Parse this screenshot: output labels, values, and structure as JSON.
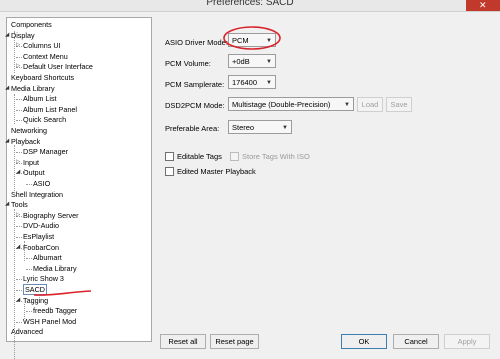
{
  "window": {
    "title": "Preferences: SACD",
    "close_label": "✕"
  },
  "tree": {
    "items": [
      {
        "label": "Components",
        "level": 0,
        "expander": ""
      },
      {
        "label": "Display",
        "level": 0,
        "expander": "◢"
      },
      {
        "label": "Columns UI",
        "level": 1,
        "expander": "▷"
      },
      {
        "label": "Context Menu",
        "level": 1,
        "expander": ""
      },
      {
        "label": "Default User Interface",
        "level": 1,
        "expander": "▷"
      },
      {
        "label": "Keyboard Shortcuts",
        "level": 0,
        "expander": ""
      },
      {
        "label": "Media Library",
        "level": 0,
        "expander": "◢"
      },
      {
        "label": "Album List",
        "level": 1,
        "expander": ""
      },
      {
        "label": "Album List Panel",
        "level": 1,
        "expander": ""
      },
      {
        "label": "Quick Search",
        "level": 1,
        "expander": ""
      },
      {
        "label": "Networking",
        "level": 0,
        "expander": ""
      },
      {
        "label": "Playback",
        "level": 0,
        "expander": "◢"
      },
      {
        "label": "DSP Manager",
        "level": 1,
        "expander": ""
      },
      {
        "label": "Input",
        "level": 1,
        "expander": "▷"
      },
      {
        "label": "Output",
        "level": 1,
        "expander": "◢"
      },
      {
        "label": "ASIO",
        "level": 2,
        "expander": ""
      },
      {
        "label": "Shell Integration",
        "level": 0,
        "expander": ""
      },
      {
        "label": "Tools",
        "level": 0,
        "expander": "◢"
      },
      {
        "label": "Biography Server",
        "level": 1,
        "expander": "▷"
      },
      {
        "label": "DVD-Audio",
        "level": 1,
        "expander": ""
      },
      {
        "label": "EsPlaylist",
        "level": 1,
        "expander": ""
      },
      {
        "label": "FoobarCon",
        "level": 1,
        "expander": "◢"
      },
      {
        "label": "Albumart",
        "level": 2,
        "expander": ""
      },
      {
        "label": "Media Library",
        "level": 2,
        "expander": ""
      },
      {
        "label": "Lyric Show 3",
        "level": 1,
        "expander": ""
      },
      {
        "label": "SACD",
        "level": 1,
        "expander": "",
        "selected": true
      },
      {
        "label": "Tagging",
        "level": 1,
        "expander": "◢"
      },
      {
        "label": "freedb Tagger",
        "level": 2,
        "expander": ""
      },
      {
        "label": "WSH Panel Mod",
        "level": 1,
        "expander": ""
      },
      {
        "label": "Advanced",
        "level": 0,
        "expander": ""
      }
    ]
  },
  "settings": {
    "asio_driver_mode": {
      "label": "ASIO Driver Mode:",
      "value": "PCM"
    },
    "pcm_volume": {
      "label": "PCM Volume:",
      "value": "+0dB"
    },
    "pcm_samplerate": {
      "label": "PCM Samplerate:",
      "value": "176400"
    },
    "dsd2pcm_mode": {
      "label": "DSD2PCM Mode:",
      "value": "Multistage (Double-Precision)",
      "load": "Load",
      "save": "Save"
    },
    "preferable_area": {
      "label": "Preferable Area:",
      "value": "Stereo"
    },
    "editable_tags": {
      "label": "Editable Tags",
      "checked": false
    },
    "store_tags": {
      "label": "Store Tags With ISO",
      "checked": false
    },
    "edited_master": {
      "label": "Edited Master Playback",
      "checked": false
    }
  },
  "footer": {
    "reset_all": "Reset all",
    "reset_page": "Reset page",
    "ok": "OK",
    "cancel": "Cancel",
    "apply": "Apply"
  },
  "colors": {
    "annotation": "#d9232b",
    "selection_border": "#6a8bb5"
  }
}
